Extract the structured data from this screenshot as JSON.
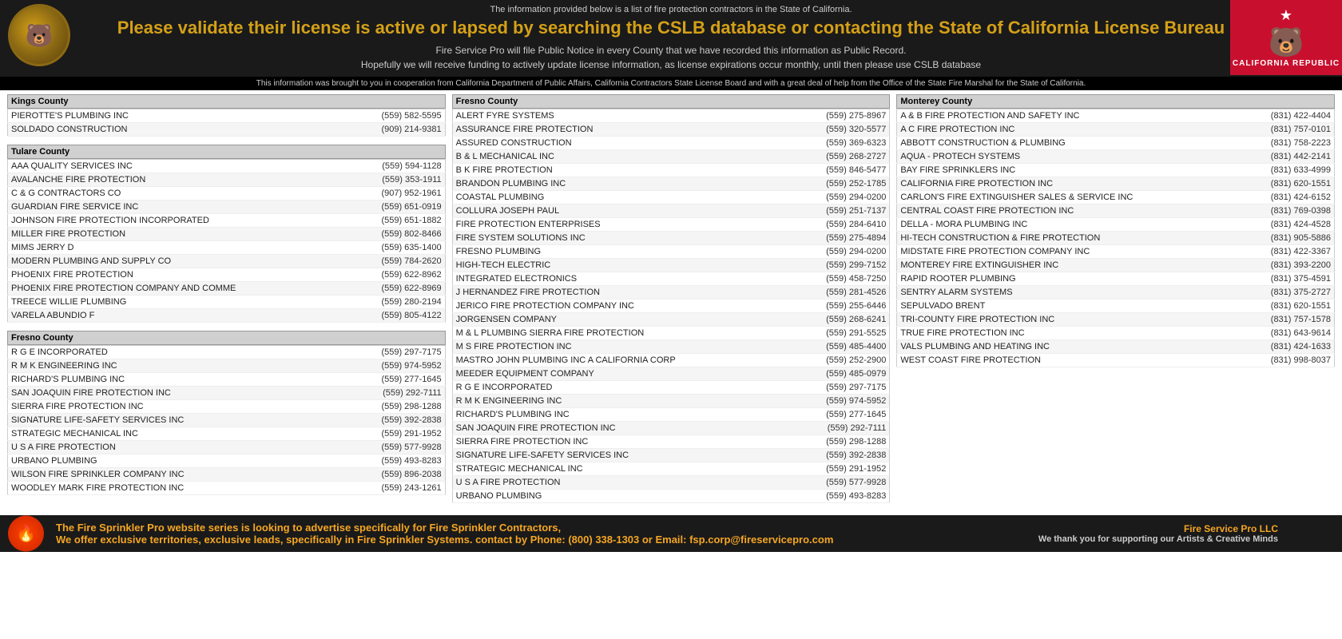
{
  "header": {
    "info_text": "The information provided below is a list of fire protection contractors in the State of California.",
    "main_title": "Please validate their license is active or lapsed by searching the CSLB database or contacting the State of California License Bureau",
    "sub_text1": "Fire Service Pro will file Public Notice in every County that we have recorded this information as Public Record.",
    "sub_text2": "Hopefully we will receive funding to actively update license information, as license expirations occur monthly, until then please use CSLB database",
    "ca_republic": "CALIFORNIA  REPUBLIC"
  },
  "info_bar": {
    "text": "This information was brought to you in cooperation from California Department of Public Affairs, California Contractors State License Board and with a great deal of help from the Office of the State Fire Marshal for the State of California."
  },
  "columns": [
    {
      "sections": [
        {
          "county": "Kings County",
          "rows": [
            {
              "name": "PIEROTTE'S PLUMBING INC",
              "phone": "(559) 582-5595"
            },
            {
              "name": "SOLDADO CONSTRUCTION",
              "phone": "(909) 214-9381"
            }
          ]
        },
        {
          "county": "Tulare County",
          "rows": [
            {
              "name": "AAA QUALITY SERVICES INC",
              "phone": "(559) 594-1128"
            },
            {
              "name": "AVALANCHE FIRE PROTECTION",
              "phone": "(559) 353-1911"
            },
            {
              "name": "C & G CONTRACTORS CO",
              "phone": "(907) 952-1961"
            },
            {
              "name": "GUARDIAN FIRE SERVICE INC",
              "phone": "(559) 651-0919"
            },
            {
              "name": "JOHNSON FIRE PROTECTION INCORPORATED",
              "phone": "(559) 651-1882"
            },
            {
              "name": "MILLER FIRE PROTECTION",
              "phone": "(559) 802-8466"
            },
            {
              "name": "MIMS JERRY D",
              "phone": "(559) 635-1400"
            },
            {
              "name": "MODERN PLUMBING AND SUPPLY CO",
              "phone": "(559) 784-2620"
            },
            {
              "name": "PHOENIX FIRE PROTECTION",
              "phone": "(559) 622-8962"
            },
            {
              "name": "PHOENIX FIRE PROTECTION COMPANY AND COMME",
              "phone": "(559) 622-8969"
            },
            {
              "name": "TREECE WILLIE PLUMBING",
              "phone": "(559) 280-2194"
            },
            {
              "name": "VARELA ABUNDIO F",
              "phone": "(559) 805-4122"
            }
          ]
        },
        {
          "county": "Fresno County",
          "rows": [
            {
              "name": "R G E INCORPORATED",
              "phone": "(559) 297-7175"
            },
            {
              "name": "R M K ENGINEERING INC",
              "phone": "(559) 974-5952"
            },
            {
              "name": "RICHARD'S PLUMBING INC",
              "phone": "(559) 277-1645"
            },
            {
              "name": "SAN JOAQUIN FIRE PROTECTION INC",
              "phone": "(559) 292-7111"
            },
            {
              "name": "SIERRA FIRE PROTECTION INC",
              "phone": "(559) 298-1288"
            },
            {
              "name": "SIGNATURE LIFE-SAFETY SERVICES INC",
              "phone": "(559) 392-2838"
            },
            {
              "name": "STRATEGIC MECHANICAL INC",
              "phone": "(559) 291-1952"
            },
            {
              "name": "U S A FIRE PROTECTION",
              "phone": "(559) 577-9928"
            },
            {
              "name": "URBANO PLUMBING",
              "phone": "(559) 493-8283"
            },
            {
              "name": "WILSON FIRE SPRINKLER COMPANY INC",
              "phone": "(559) 896-2038"
            },
            {
              "name": "WOODLEY MARK FIRE PROTECTION INC",
              "phone": "(559) 243-1261"
            }
          ]
        }
      ]
    },
    {
      "sections": [
        {
          "county": "Fresno County",
          "rows": [
            {
              "name": "ALERT FYRE SYSTEMS",
              "phone": "(559) 275-8967"
            },
            {
              "name": "ASSURANCE FIRE PROTECTION",
              "phone": "(559) 320-5577"
            },
            {
              "name": "ASSURED CONSTRUCTION",
              "phone": "(559) 369-6323"
            },
            {
              "name": "B & L MECHANICAL INC",
              "phone": "(559) 268-2727"
            },
            {
              "name": "B K FIRE PROTECTION",
              "phone": "(559) 846-5477"
            },
            {
              "name": "BRANDON PLUMBING INC",
              "phone": "(559) 252-1785"
            },
            {
              "name": "COASTAL PLUMBING",
              "phone": "(559) 294-0200"
            },
            {
              "name": "COLLURA JOSEPH PAUL",
              "phone": "(559) 251-7137"
            },
            {
              "name": "FIRE PROTECTION ENTERPRISES",
              "phone": "(559) 284-6410"
            },
            {
              "name": "FIRE SYSTEM SOLUTIONS INC",
              "phone": "(559) 275-4894"
            },
            {
              "name": "FRESNO PLUMBING",
              "phone": "(559) 294-0200"
            },
            {
              "name": "HIGH-TECH ELECTRIC",
              "phone": "(559) 299-7152"
            },
            {
              "name": "INTEGRATED ELECTRONICS",
              "phone": "(559) 458-7250"
            },
            {
              "name": "J HERNANDEZ FIRE PROTECTION",
              "phone": "(559) 281-4526"
            },
            {
              "name": "JERICO FIRE PROTECTION COMPANY INC",
              "phone": "(559) 255-6446"
            },
            {
              "name": "JORGENSEN COMPANY",
              "phone": "(559) 268-6241"
            },
            {
              "name": "M & L PLUMBING SIERRA FIRE PROTECTION",
              "phone": "(559) 291-5525"
            },
            {
              "name": "M S FIRE PROTECTION INC",
              "phone": "(559) 485-4400"
            },
            {
              "name": "MASTRO JOHN PLUMBING INC A CALIFORNIA CORP",
              "phone": "(559) 252-2900"
            },
            {
              "name": "MEEDER EQUIPMENT COMPANY",
              "phone": "(559) 485-0979"
            },
            {
              "name": "R G E INCORPORATED",
              "phone": "(559) 297-7175"
            },
            {
              "name": "R M K ENGINEERING INC",
              "phone": "(559) 974-5952"
            },
            {
              "name": "RICHARD'S PLUMBING INC",
              "phone": "(559) 277-1645"
            },
            {
              "name": "SAN JOAQUIN FIRE PROTECTION INC",
              "phone": "(559) 292-7111"
            },
            {
              "name": "SIERRA FIRE PROTECTION INC",
              "phone": "(559) 298-1288"
            },
            {
              "name": "SIGNATURE LIFE-SAFETY SERVICES INC",
              "phone": "(559) 392-2838"
            },
            {
              "name": "STRATEGIC MECHANICAL INC",
              "phone": "(559) 291-1952"
            },
            {
              "name": "U S A FIRE PROTECTION",
              "phone": "(559) 577-9928"
            },
            {
              "name": "URBANO PLUMBING",
              "phone": "(559) 493-8283"
            }
          ]
        }
      ]
    },
    {
      "sections": [
        {
          "county": "Monterey County",
          "rows": [
            {
              "name": "A & B FIRE PROTECTION AND SAFETY INC",
              "phone": "(831) 422-4404"
            },
            {
              "name": "A C FIRE PROTECTION INC",
              "phone": "(831) 757-0101"
            },
            {
              "name": "ABBOTT CONSTRUCTION & PLUMBING",
              "phone": "(831) 758-2223"
            },
            {
              "name": "AQUA - PROTECH SYSTEMS",
              "phone": "(831) 442-2141"
            },
            {
              "name": "BAY FIRE SPRINKLERS INC",
              "phone": "(831) 633-4999"
            },
            {
              "name": "CALIFORNIA FIRE PROTECTION INC",
              "phone": "(831) 620-1551"
            },
            {
              "name": "CARLON'S FIRE EXTINGUISHER SALES & SERVICE INC",
              "phone": "(831) 424-6152"
            },
            {
              "name": "CENTRAL COAST FIRE PROTECTION INC",
              "phone": "(831) 769-0398"
            },
            {
              "name": "DELLA - MORA PLUMBING INC",
              "phone": "(831) 424-4528"
            },
            {
              "name": "HI-TECH CONSTRUCTION & FIRE PROTECTION",
              "phone": "(831) 905-5886"
            },
            {
              "name": "MIDSTATE FIRE PROTECTION COMPANY INC",
              "phone": "(831) 422-3367"
            },
            {
              "name": "MONTEREY FIRE EXTINGUISHER INC",
              "phone": "(831) 393-2200"
            },
            {
              "name": "RAPID ROOTER PLUMBING",
              "phone": "(831) 375-4591"
            },
            {
              "name": "SENTRY ALARM SYSTEMS",
              "phone": "(831) 375-2727"
            },
            {
              "name": "SEPULVADO BRENT",
              "phone": "(831) 620-1551"
            },
            {
              "name": "TRI-COUNTY FIRE PROTECTION INC",
              "phone": "(831) 757-1578"
            },
            {
              "name": "TRUE FIRE PROTECTION INC",
              "phone": "(831) 643-9614"
            },
            {
              "name": "VALS PLUMBING AND HEATING INC",
              "phone": "(831) 424-1633"
            },
            {
              "name": "WEST COAST FIRE PROTECTION",
              "phone": "(831) 998-8037"
            }
          ]
        }
      ]
    }
  ],
  "footer": {
    "text_line1": "The Fire Sprinkler Pro website series is looking to advertise specifically for Fire Sprinkler Contractors,",
    "text_line2": "We offer exclusive territories, exclusive leads, specifically in Fire Sprinkler Systems. contact by Phone: (800) 338-1303 or Email: fsp.corp@fireservicepro.com",
    "company_name": "Fire Service Pro LLC",
    "thanks_text": "We thank you for supporting our Artists & Creative Minds"
  }
}
